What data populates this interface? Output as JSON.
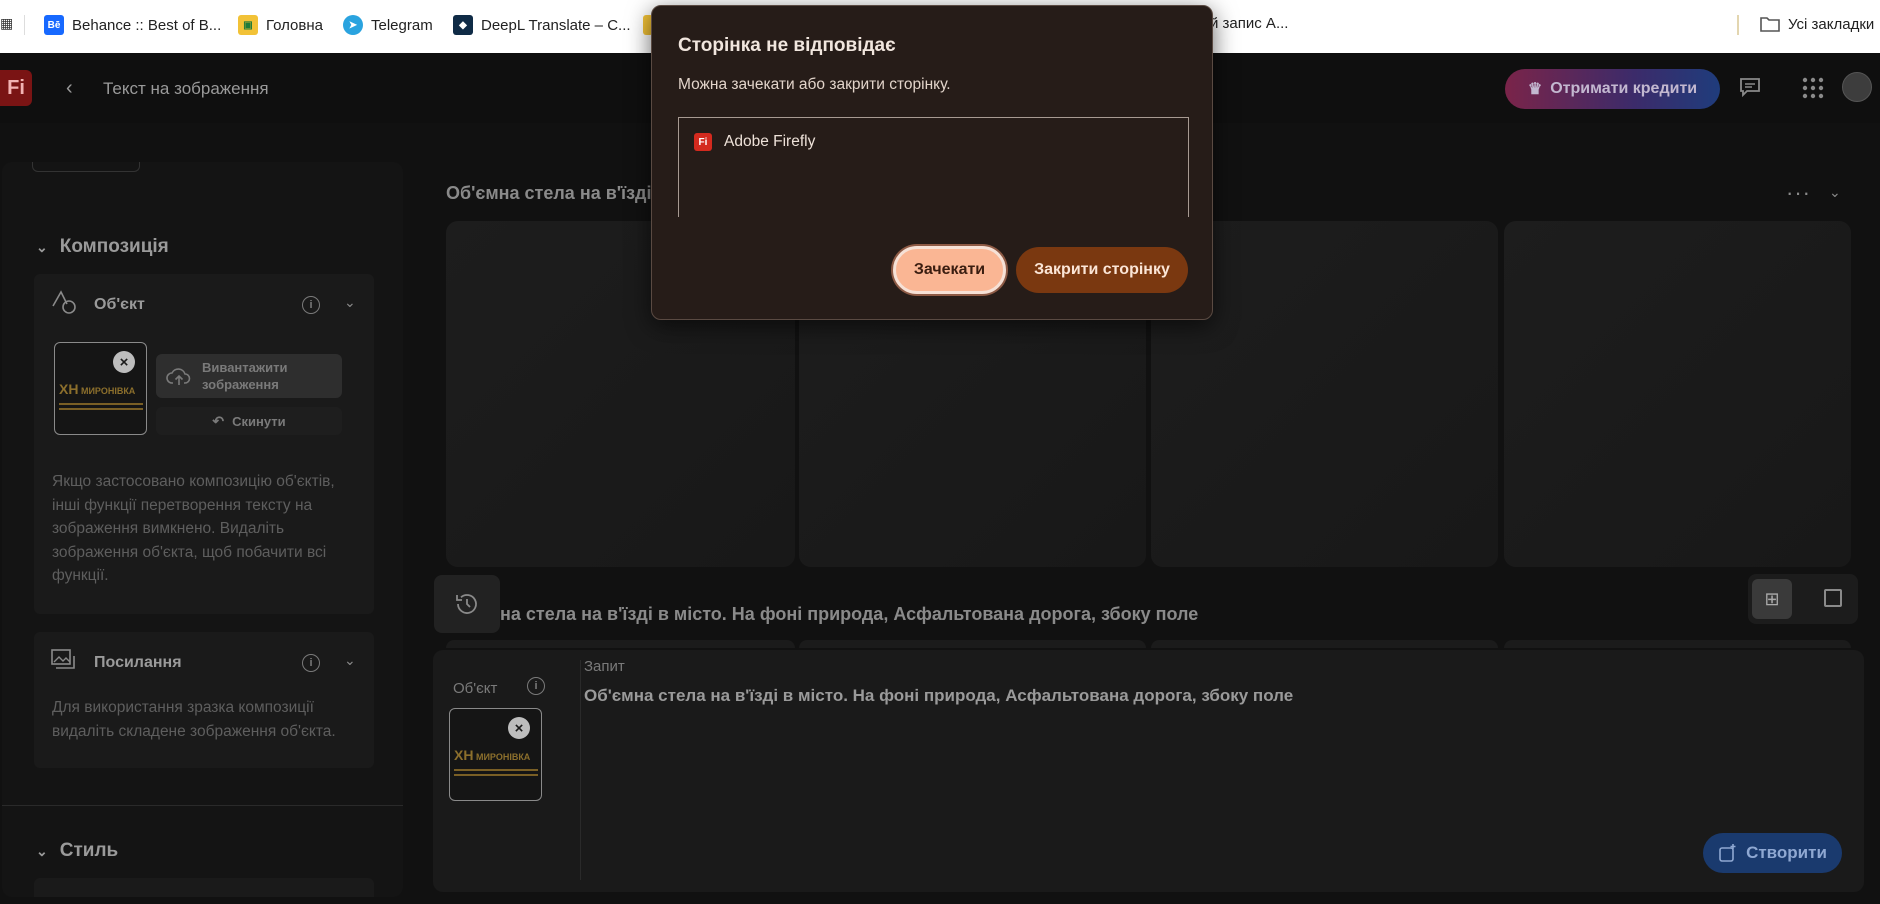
{
  "bookmarks": {
    "items": [
      {
        "label": "Behance :: Best of B...",
        "icon": "behance-icon"
      },
      {
        "label": "Головна",
        "icon": "classroom-icon"
      },
      {
        "label": "Telegram",
        "icon": "telegram-icon"
      },
      {
        "label": "DeepL Translate – С...",
        "icon": "deepl-icon"
      },
      {
        "label": "й запис А...",
        "icon": "partial-icon"
      }
    ],
    "all_bookmarks": "Усі закладки"
  },
  "app": {
    "logo": "Fi",
    "title": "Текст на зображення",
    "credits_button": "Отримати кредити"
  },
  "left_panel": {
    "composition_heading": "Композиція",
    "object_card": {
      "title": "Об'єкт",
      "upload_button": "Вивантажити зображення",
      "reset_button": "Скинути",
      "note": "Якщо застосовано композицію об'єктів, інші функції перетворення тексту на зображення вимкнено. Видаліть зображення об'єкта, щоб побачити всі функції."
    },
    "reference_card": {
      "title": "Посилання",
      "note": "Для використання зразка композиції видаліть складене зображення об'єкта."
    },
    "style_heading": "Стиль"
  },
  "thumbnail": {
    "logo_mark": "ХН",
    "logo_text": "МИРОНІВКА"
  },
  "main": {
    "generation_title": "Об'ємна стела на в'їзді в",
    "generation_title_2": "на стела на в'їзді в місто. На фоні природа, Асфальтована дорога, збоку поле"
  },
  "prompt_panel": {
    "object_label": "Об'єкт",
    "prompt_label": "Запит",
    "prompt_text": "Об'ємна стела на в'їзді в місто. На фоні природа, Асфальтована дорога, збоку поле",
    "create_button": "Створити"
  },
  "dialog": {
    "title": "Сторінка не відповідає",
    "message": "Можна зачекати або закрити сторінку.",
    "item_label": "Adobe Firefly",
    "item_icon_text": "Fi",
    "wait_button": "Зачекати",
    "close_button": "Закрити сторінку"
  },
  "colors": {
    "dialog_bg": "#261c18",
    "wait_button": "#fab694",
    "close_button": "#7a3810",
    "create_button": "#1a3a6e",
    "brand_red": "#d42a1e"
  }
}
